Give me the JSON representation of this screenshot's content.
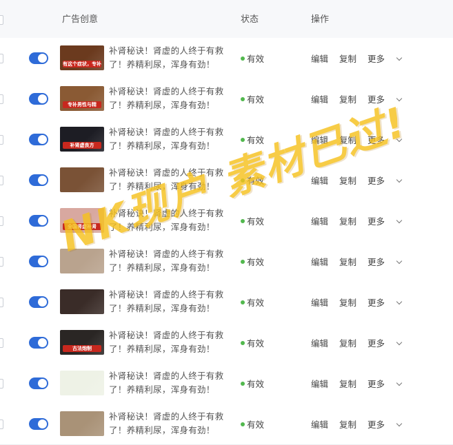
{
  "header": {
    "creative": "广告创意",
    "status": "状态",
    "actions": "操作"
  },
  "rows": [
    {
      "thumb_caption": "有这个症状，专补肾精与血",
      "thumb_color": "#6b3a1e",
      "text": "补肾秘诀！肾虚的人终于有救了！养精利尿，浑身有劲！",
      "status": "有效",
      "edit": "编辑",
      "copy": "复制",
      "more": "更多"
    },
    {
      "thumb_caption": "专补男性与精",
      "thumb_color": "#8a5a34",
      "text": "补肾秘诀！肾虚的人终于有救了！养精利尿，浑身有劲！",
      "status": "有效",
      "edit": "编辑",
      "copy": "复制",
      "more": "更多"
    },
    {
      "thumb_caption": "补肾虚良方",
      "thumb_color": "#1d1d24",
      "text": "补肾秘诀！肾虚的人终于有救了！养精利尿，浑身有劲！",
      "status": "有效",
      "edit": "编辑",
      "copy": "复制",
      "more": "更多"
    },
    {
      "thumb_caption": "",
      "thumb_color": "#7a5236",
      "text": "补肾秘诀！肾虚的人终于有救了！养精利尿，浑身有劲！",
      "status": "有效",
      "edit": "编辑",
      "copy": "复制",
      "more": "更多"
    },
    {
      "thumb_caption": "全国肾虚补肾",
      "thumb_color": "#d8a8a0",
      "text": "补肾秘诀！肾虚的人终于有救了！养精利尿，浑身有劲！",
      "status": "有效",
      "edit": "编辑",
      "copy": "复制",
      "more": "更多"
    },
    {
      "thumb_caption": "",
      "thumb_color": "#b9a38e",
      "text": "补肾秘诀！肾虚的人终于有救了！养精利尿，浑身有劲！",
      "status": "有效",
      "edit": "编辑",
      "copy": "复制",
      "more": "更多"
    },
    {
      "thumb_caption": "",
      "thumb_color": "#3a2c28",
      "text": "补肾秘诀！肾虚的人终于有救了！养精利尿，浑身有劲！",
      "status": "有效",
      "edit": "编辑",
      "copy": "复制",
      "more": "更多"
    },
    {
      "thumb_caption": "古法炮制",
      "thumb_color": "#2a2624",
      "text": "补肾秘诀！肾虚的人终于有救了！养精利尿，浑身有劲！",
      "status": "有效",
      "edit": "编辑",
      "copy": "复制",
      "more": "更多"
    },
    {
      "thumb_caption": "",
      "thumb_color": "#eef2e6",
      "text": "补肾秘诀！肾虚的人终于有救了！养精利尿，浑身有劲！",
      "status": "有效",
      "edit": "编辑",
      "copy": "复制",
      "more": "更多"
    },
    {
      "thumb_caption": "",
      "thumb_color": "#a99277",
      "text": "补肾秘诀！肾虚的人终于有救了！养精利尿，浑身有劲！",
      "status": "有效",
      "edit": "编辑",
      "copy": "复制",
      "more": "更多"
    }
  ],
  "watermark": "NK现户 素材已过!",
  "colors": {
    "toggle_on": "#2e6bd8",
    "status_ok": "#52b84e",
    "watermark": "#f6c11e"
  }
}
